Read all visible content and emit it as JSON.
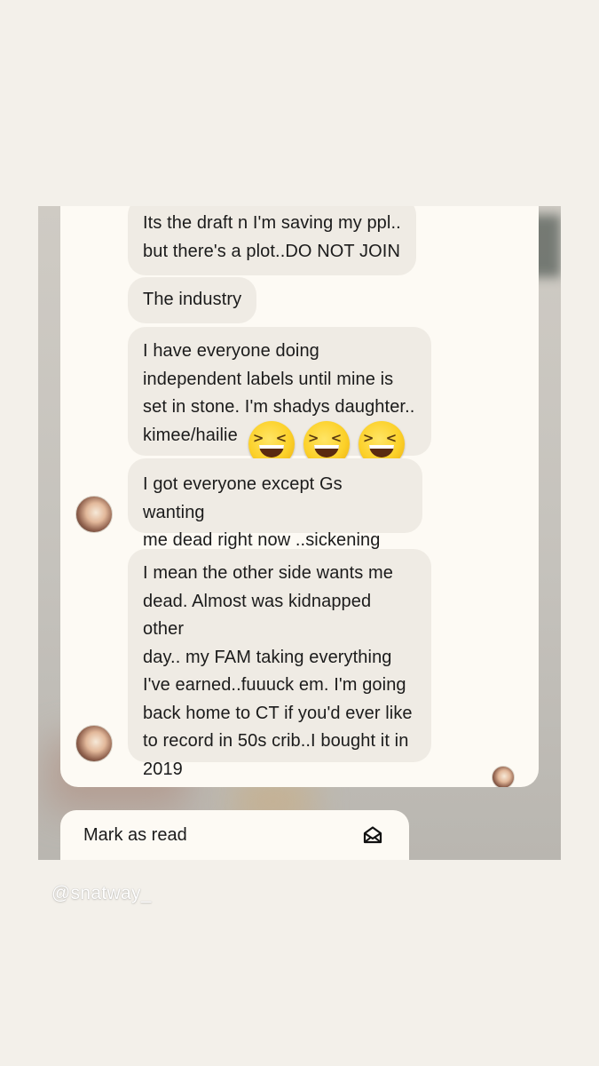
{
  "messages": [
    "Its the draft n I'm saving my ppl..\nbut there's a plot..DO NOT JOIN",
    "The industry",
    "I have everyone doing\nindependent labels until mine is\nset in stone.  I'm shadys daughter..\nkimee/hailie",
    "I got everyone except Gs wanting\nme dead right now ..sickening",
    "I mean the other side wants me\ndead. Almost was kidnapped other\nday.. my FAM taking everything\nI've earned..fuuuck em.  I'm going\nback home to CT if you'd ever like\nto record in 50s crib..I bought it in\n2019"
  ],
  "emojis": [
    "laughing-emoji",
    "laughing-emoji",
    "laughing-emoji"
  ],
  "mark_as_read": {
    "label": "Mark as read",
    "icon": "envelope-open-icon"
  },
  "watermark": "@snatway_"
}
